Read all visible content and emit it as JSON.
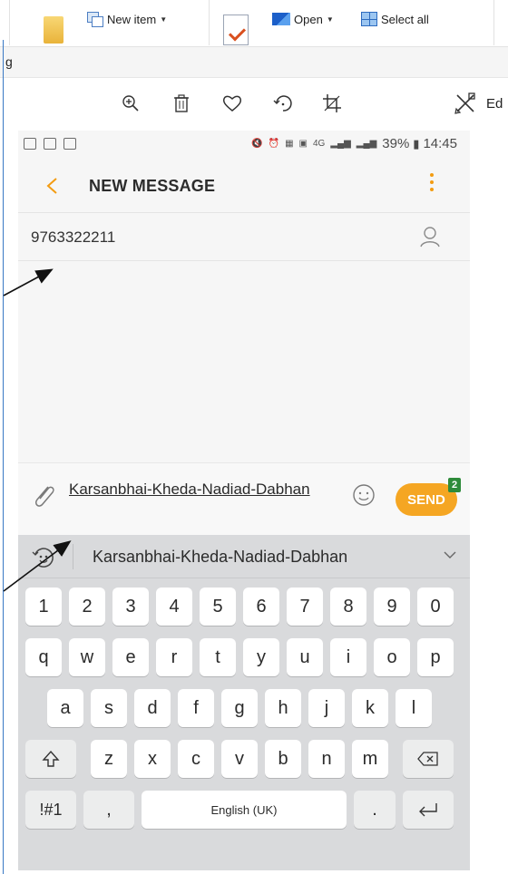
{
  "ribbon": {
    "new_item_label": "New item",
    "open_label": "Open",
    "select_all_label": "Select all"
  },
  "address": {
    "text": "g"
  },
  "viewer": {
    "edit_label": "Ed"
  },
  "status_bar": {
    "network": "4G",
    "battery": "39%",
    "time": "14:45"
  },
  "app_bar": {
    "title": "NEW MESSAGE"
  },
  "recipient": {
    "value": "9763322211"
  },
  "compose": {
    "message": "Karsanbhai-Kheda-Nadiad-Dabhan",
    "send_label": "SEND",
    "send_count": "2"
  },
  "keyboard": {
    "suggestion": "Karsanbhai-Kheda-Nadiad-Dabhan",
    "row_numbers": [
      "1",
      "2",
      "3",
      "4",
      "5",
      "6",
      "7",
      "8",
      "9",
      "0"
    ],
    "row_1": [
      "q",
      "w",
      "e",
      "r",
      "t",
      "y",
      "u",
      "i",
      "o",
      "p"
    ],
    "row_2": [
      "a",
      "s",
      "d",
      "f",
      "g",
      "h",
      "j",
      "k",
      "l"
    ],
    "row_3": [
      "z",
      "x",
      "c",
      "v",
      "b",
      "n",
      "m"
    ],
    "symbols_label": "!#1",
    "comma_label": ",",
    "space_label": "English (UK)",
    "period_label": "."
  },
  "colors": {
    "accent": "#f5a623",
    "badge": "#2e8b3a",
    "keyboard_bg": "#d9dadc"
  }
}
